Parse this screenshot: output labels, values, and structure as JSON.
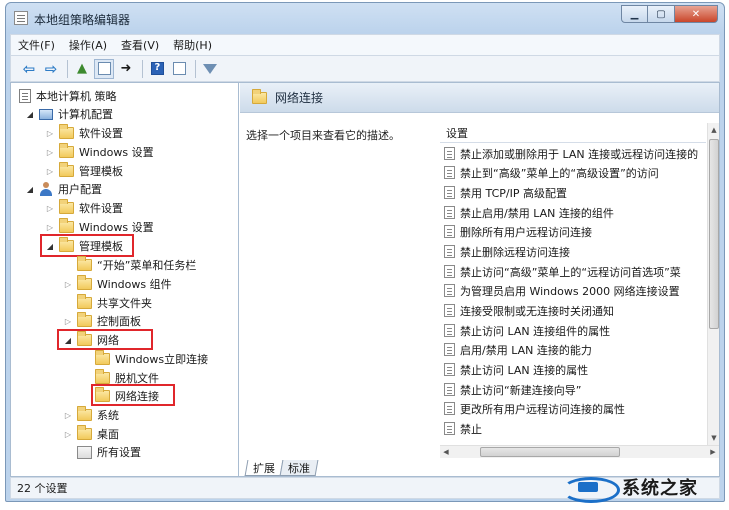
{
  "window": {
    "title": "本地组策略编辑器",
    "minimize": "▁",
    "maximize": "▢",
    "close": "✕"
  },
  "menu": [
    "文件(F)",
    "操作(A)",
    "查看(V)",
    "帮助(H)"
  ],
  "toolbar": {
    "back": "⇦",
    "forward": "⇨",
    "up": "▲",
    "export": "➜"
  },
  "tree": {
    "root": "本地计算机 策略",
    "items": [
      "计算机配置",
      "软件设置",
      "Windows 设置",
      "管理模板",
      "用户配置",
      "软件设置",
      "Windows 设置",
      "管理模板",
      "“开始”菜单和任务栏",
      "Windows 组件",
      "共享文件夹",
      "控制面板",
      "网络",
      "Windows立即连接",
      "脱机文件",
      "网络连接",
      "系统",
      "桌面",
      "所有设置"
    ]
  },
  "right": {
    "title": "网络连接",
    "description": "选择一个项目来查看它的描述。",
    "column_header": "设置",
    "settings": [
      "禁止添加或删除用于 LAN 连接或远程访问连接的",
      "禁止到“高级”菜单上的“高级设置”的访问",
      "禁用 TCP/IP 高级配置",
      "禁止启用/禁用 LAN 连接的组件",
      "删除所有用户远程访问连接",
      "禁止删除远程访问连接",
      "禁止访问“高级”菜单上的“远程访问首选项”菜",
      "为管理员启用 Windows 2000 网络连接设置",
      "连接受限制或无连接时关闭通知",
      "禁止访问 LAN 连接组件的属性",
      "启用/禁用 LAN 连接的能力",
      "禁止访问 LAN 连接的属性",
      "禁止访问“新建连接向导”",
      "更改所有用户远程访问连接的属性",
      "禁止"
    ],
    "tabs": [
      "扩展",
      "标准"
    ]
  },
  "status": {
    "text": "22 个设置"
  },
  "watermark": {
    "text": "系统之家"
  }
}
